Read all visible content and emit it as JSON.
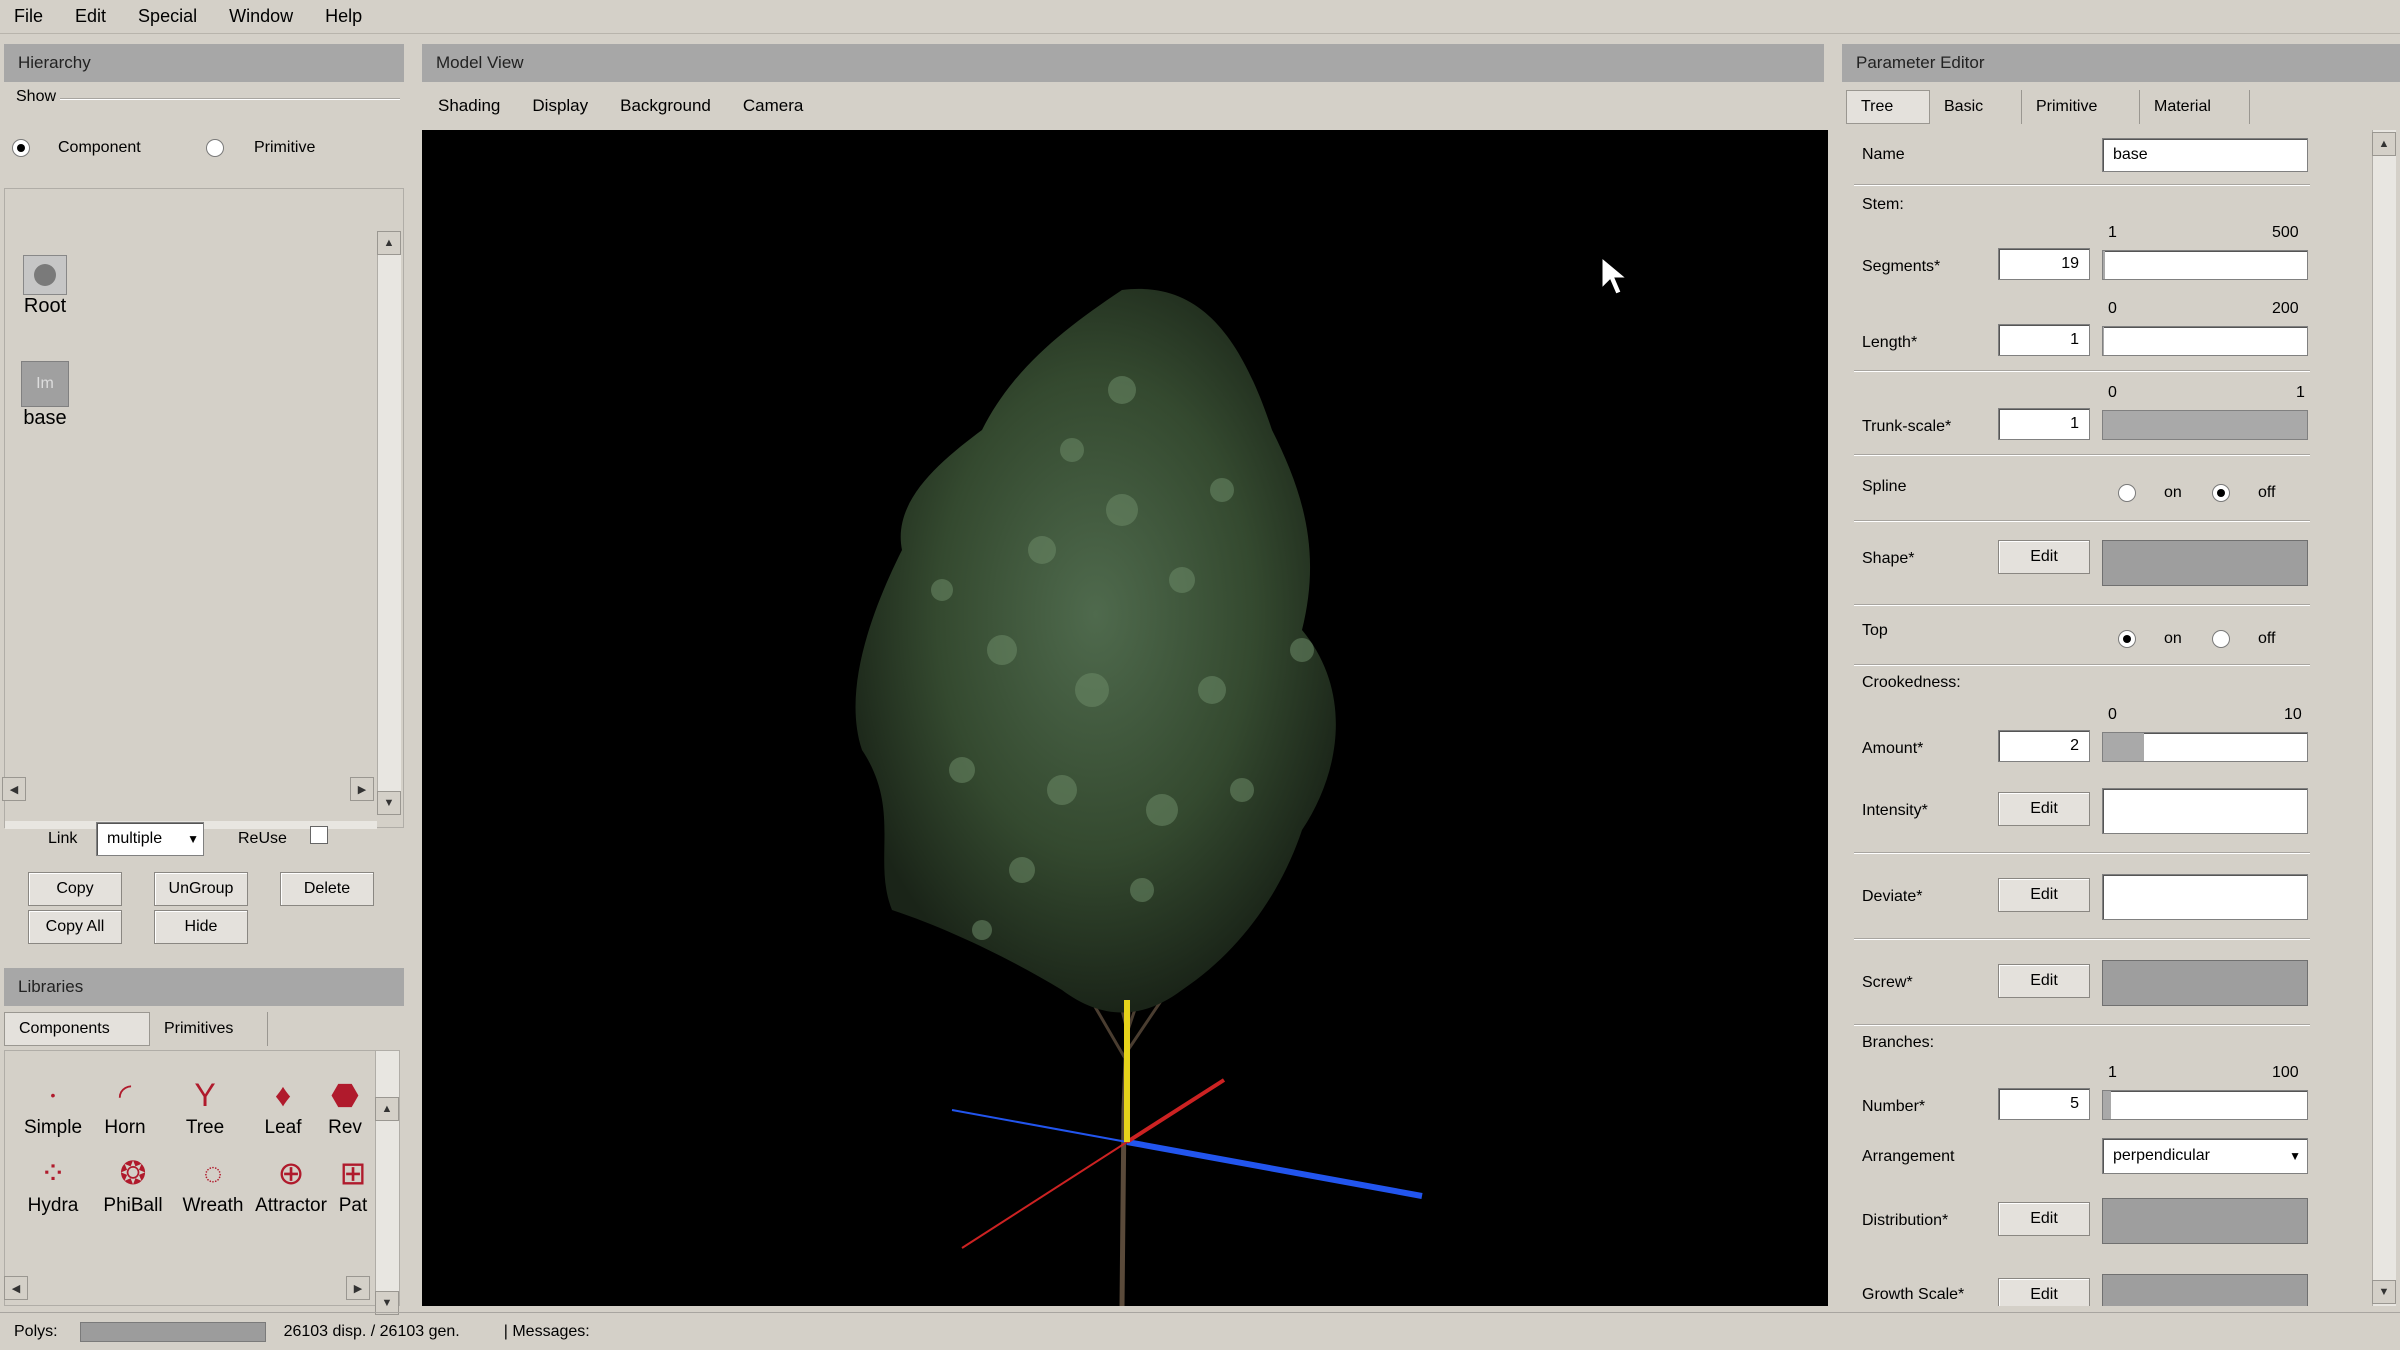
{
  "menu": [
    "File",
    "Edit",
    "Special",
    "Window",
    "Help"
  ],
  "hierarchy": {
    "title": "Hierarchy",
    "show_label": "Show",
    "radio_component": "Component",
    "radio_primitive": "Primitive",
    "nodes": [
      "Root",
      "base"
    ],
    "link_label": "Link",
    "link_value": "multiple",
    "reuse_label": "ReUse",
    "buttons": {
      "copy": "Copy",
      "ungroup": "UnGroup",
      "delete": "Delete",
      "copy_all": "Copy All",
      "hide": "Hide"
    }
  },
  "libraries": {
    "title": "Libraries",
    "tabs": [
      "Components",
      "Primitives"
    ],
    "items_row1": [
      "Simple",
      "Horn",
      "Tree",
      "Leaf",
      "Rev"
    ],
    "items_row2": [
      "Hydra",
      "PhiBall",
      "Wreath",
      "Attractor",
      "Pat"
    ]
  },
  "model_view": {
    "title": "Model View",
    "menu": [
      "Shading",
      "Display",
      "Background",
      "Camera"
    ]
  },
  "param_editor": {
    "title": "Parameter Editor",
    "tabs": [
      "Tree",
      "Basic",
      "Primitive",
      "Material"
    ],
    "name_label": "Name",
    "name_value": "base",
    "stem_label": "Stem:",
    "segments": {
      "label": "Segments*",
      "value": "19",
      "min": "1",
      "max": "500"
    },
    "length": {
      "label": "Length*",
      "value": "1",
      "min": "0",
      "max": "200"
    },
    "trunk_scale": {
      "label": "Trunk-scale*",
      "value": "1",
      "min": "0",
      "max": "1"
    },
    "spline": {
      "label": "Spline",
      "on": "on",
      "off": "off"
    },
    "shape": {
      "label": "Shape*"
    },
    "top": {
      "label": "Top",
      "on": "on",
      "off": "off"
    },
    "crookedness_label": "Crookedness:",
    "amount": {
      "label": "Amount*",
      "value": "2",
      "min": "0",
      "max": "10"
    },
    "intensity": {
      "label": "Intensity*"
    },
    "deviate": {
      "label": "Deviate*"
    },
    "screw": {
      "label": "Screw*"
    },
    "branches_label": "Branches:",
    "number": {
      "label": "Number*",
      "value": "5",
      "min": "1",
      "max": "100"
    },
    "arrangement": {
      "label": "Arrangement",
      "value": "perpendicular"
    },
    "distribution": {
      "label": "Distribution*"
    },
    "growth_scale": {
      "label": "Growth Scale*"
    },
    "edit_label": "Edit"
  },
  "status": {
    "polys_label": "Polys:",
    "polys_value": "26103 disp. / 26103 gen.",
    "messages_label": "| Messages:"
  },
  "colors": {
    "viewport_bg": "#000000",
    "panel_bg": "#d4d0c8",
    "titlebar": "#a7a7a7",
    "axis_x": "#cc2222",
    "axis_y": "#e6d21a",
    "axis_z": "#2255ee"
  }
}
